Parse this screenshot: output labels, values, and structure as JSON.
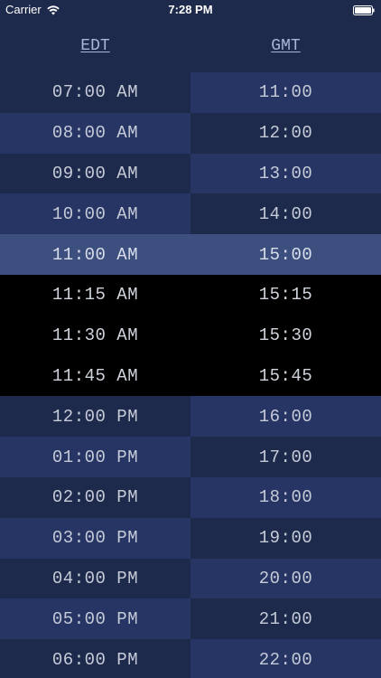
{
  "status_bar": {
    "carrier": "Carrier",
    "time": "7:28 PM",
    "wifi_icon": "wifi-icon",
    "battery_icon": "battery-icon"
  },
  "header": {
    "left_label": "EDT",
    "right_label": "GMT"
  },
  "colors": {
    "background": "#1e2a4c",
    "row_alt": "#263563",
    "selected": "#3c4f7f",
    "expanded": "#000000",
    "header_text": "#aab6d6"
  },
  "rows": [
    {
      "edt": "07:00 AM",
      "gmt": "11:00",
      "state": "normal"
    },
    {
      "edt": "08:00 AM",
      "gmt": "12:00",
      "state": "normal"
    },
    {
      "edt": "09:00 AM",
      "gmt": "13:00",
      "state": "normal"
    },
    {
      "edt": "10:00 AM",
      "gmt": "14:00",
      "state": "normal"
    },
    {
      "edt": "11:00 AM",
      "gmt": "15:00",
      "state": "selected"
    },
    {
      "edt": "11:15 AM",
      "gmt": "15:15",
      "state": "expanded"
    },
    {
      "edt": "11:30 AM",
      "gmt": "15:30",
      "state": "expanded"
    },
    {
      "edt": "11:45 AM",
      "gmt": "15:45",
      "state": "expanded"
    },
    {
      "edt": "12:00 PM",
      "gmt": "16:00",
      "state": "normal"
    },
    {
      "edt": "01:00 PM",
      "gmt": "17:00",
      "state": "normal"
    },
    {
      "edt": "02:00 PM",
      "gmt": "18:00",
      "state": "normal"
    },
    {
      "edt": "03:00 PM",
      "gmt": "19:00",
      "state": "normal"
    },
    {
      "edt": "04:00 PM",
      "gmt": "20:00",
      "state": "normal"
    },
    {
      "edt": "05:00 PM",
      "gmt": "21:00",
      "state": "normal"
    },
    {
      "edt": "06:00 PM",
      "gmt": "22:00",
      "state": "normal"
    }
  ]
}
